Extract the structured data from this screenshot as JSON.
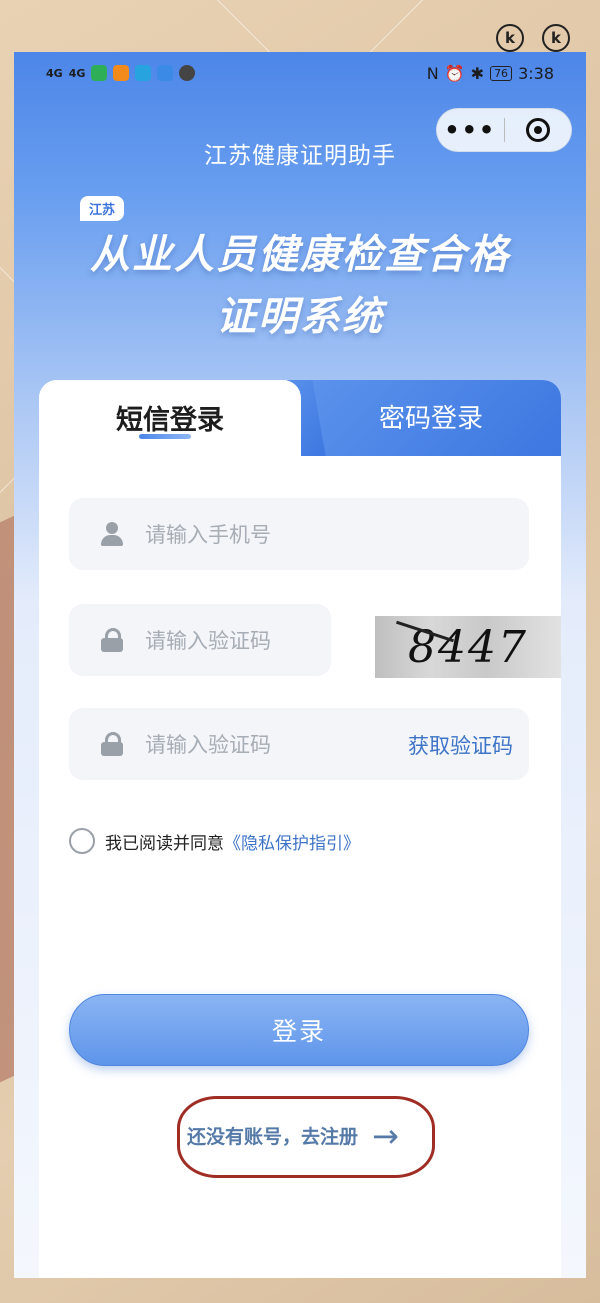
{
  "statusbar": {
    "signal1": "4G",
    "signal2": "4G",
    "battery": "76",
    "time": "3:38"
  },
  "capsule": {
    "more": "•••"
  },
  "header": {
    "title": "江苏健康证明助手",
    "tag": "江苏",
    "hero_line1": "从业人员健康检查合格",
    "hero_line2": "证明系统"
  },
  "tabs": {
    "active": "短信登录",
    "inactive": "密码登录"
  },
  "form": {
    "phone_placeholder": "请输入手机号",
    "captcha_placeholder": "请输入验证码",
    "captcha_text": "8447",
    "sms_placeholder": "请输入验证码",
    "get_code": "获取验证码",
    "agree_text": "我已阅读并同意",
    "agree_link": "《隐私保护指引》",
    "login": "登录",
    "register": "还没有账号，去注册",
    "register_arrow": "→"
  },
  "colors": {
    "primary": "#3e74c7",
    "tab_blue": "#4a85e6",
    "annotation_red": "#9f2d24"
  }
}
